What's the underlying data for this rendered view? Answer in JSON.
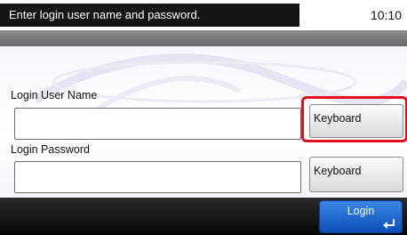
{
  "header": {
    "message": "Enter login user name and password.",
    "time": "10:10"
  },
  "form": {
    "username_label": "Login User Name",
    "username_value": "",
    "password_label": "Login Password",
    "password_value": "",
    "username_keyboard_label": "Keyboard",
    "password_keyboard_label": "Keyboard"
  },
  "footer": {
    "login_label": "Login"
  },
  "icons": {
    "enter": "enter-icon"
  },
  "colors": {
    "highlight": "#e0101e",
    "login_button": "#1f66d0"
  }
}
